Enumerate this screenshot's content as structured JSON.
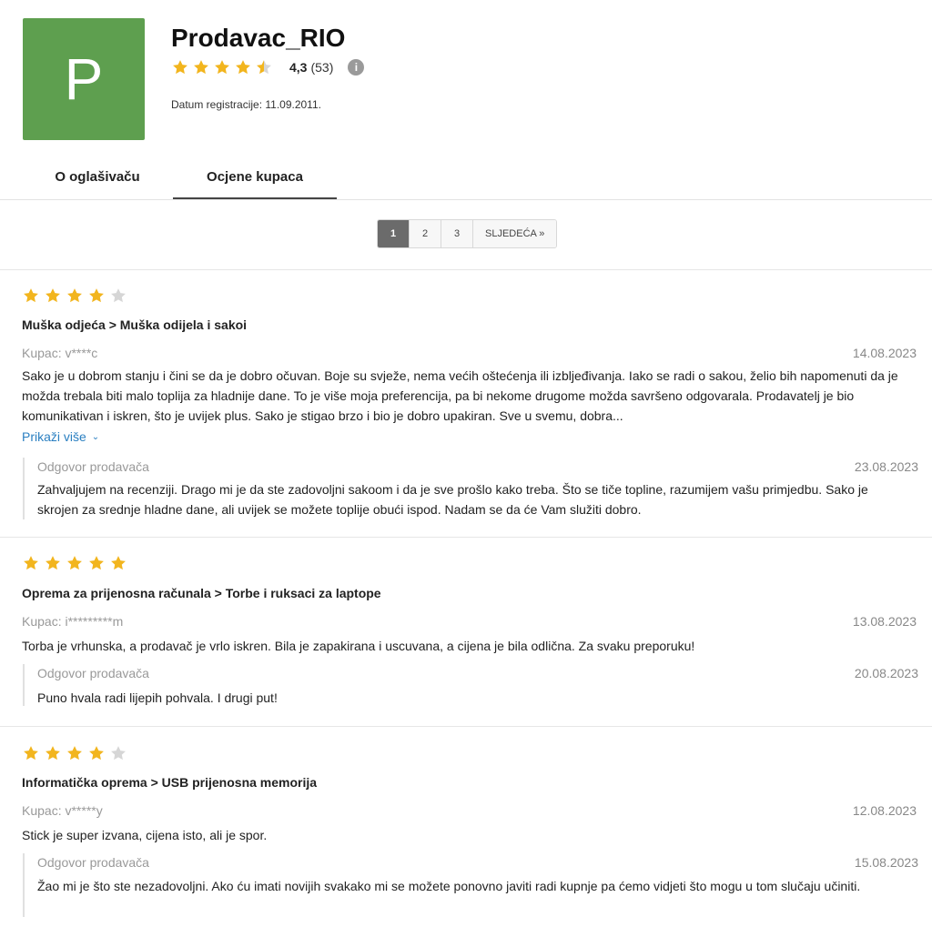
{
  "seller": {
    "initial": "P",
    "name": "Prodavac_RIO",
    "rating_value": "4,3",
    "rating_count": "(53)",
    "rating_stars": 4.5,
    "info_icon": "info-icon",
    "registration": "Datum registracije: 11.09.2011.",
    "avatar_color": "#5e9f4f"
  },
  "tabs": [
    {
      "label": "O oglašivaču",
      "active": false
    },
    {
      "label": "Ocjene kupaca",
      "active": true
    }
  ],
  "pagination": {
    "pages": [
      "1",
      "2",
      "3"
    ],
    "current": "1",
    "next_label": "SLJEDEĆA »"
  },
  "colors": {
    "star_filled": "#f2b51e",
    "star_empty": "#d6d6d6",
    "link": "#2a7fc1"
  },
  "reviews": [
    {
      "stars": 4,
      "category": "Muška odjeća > Muška odijela i sakoi",
      "buyer": "Kupac: v****c",
      "date": "14.08.2023",
      "text": "Sako je u dobrom stanju i čini se da je dobro očuvan. Boje su svježe, nema većih oštećenja ili izblјeđivanja. Iako se radi o sakou, želio bih napomenuti da je možda trebala biti malo toplija za hladnije dane. To je više moja preferencija, pa bi nekome drugome možda savršeno odgovarala. Prodavatelj je bio komunikativan i iskren, što je uvijek plus. Sako je stigao brzo i bio je dobro upakiran. Sve u svemu, dobra...",
      "show_more": "Prikaži više",
      "reply_label": "Odgovor prodavača",
      "reply_date": "23.08.2023",
      "reply_text": "Zahvaljujem na recenziji. Drago mi je da ste zadovoljni sakoom i da je sve prošlo kako treba. Što se tiče topline, razumijem vašu primjedbu. Sako je skrojen za srednje hladne dane, ali uvijek se možete toplije obući ispod. Nadam se da će Vam služiti dobro."
    },
    {
      "stars": 5,
      "category": "Oprema za prijenosna računala > Torbe i ruksaci za laptope",
      "buyer": "Kupac: i*********m",
      "date": "13.08.2023",
      "text": "Torba je vrhunska, a prodavač je vrlo iskren. Bila je zapakirana i uscuvana, a cijena je bila odlična. Za svaku preporuku!",
      "reply_label": "Odgovor prodavača",
      "reply_date": "20.08.2023",
      "reply_text": "Puno hvala radi lijepih pohvala. I drugi put!"
    },
    {
      "stars": 4,
      "category": "Informatička oprema > USB prijenosna memorija",
      "buyer": "Kupac: v*****y",
      "date": "12.08.2023",
      "text": "Stick je super izvana, cijena isto, ali je spor.",
      "reply_label": "Odgovor prodavača",
      "reply_date": "15.08.2023",
      "reply_text": "Žao mi je što ste nezadovoljni. Ako ću imati novijih svakako mi se možete ponovno javiti radi kupnje pa ćemo vidjeti što mogu u tom slučaju učiniti."
    }
  ]
}
